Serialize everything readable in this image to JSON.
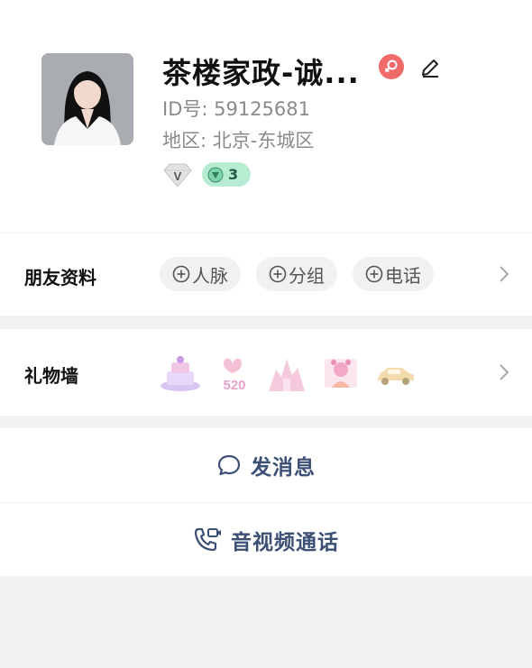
{
  "profile": {
    "name": "茶楼家政-诚...",
    "id_text": "ID号: 59125681",
    "region_text": "地区: 北京-东城区",
    "vip_label": "V",
    "level": "3",
    "gender_icon": "female-icon"
  },
  "friend_info": {
    "title": "朋友资料",
    "chips": [
      "人脉",
      "分组",
      "电话"
    ]
  },
  "gift_wall": {
    "title": "礼物墙",
    "gifts": [
      "cake-gift-icon",
      "520-gift-icon",
      "castle-gift-icon",
      "doll-gift-icon",
      "car-gift-icon"
    ]
  },
  "actions": {
    "message": "发消息",
    "call": "音视频通话"
  },
  "colors": {
    "accent_text": "#3c4f74",
    "gender_badge": "#f06a6a",
    "level_badge": "#b8ecd2"
  }
}
